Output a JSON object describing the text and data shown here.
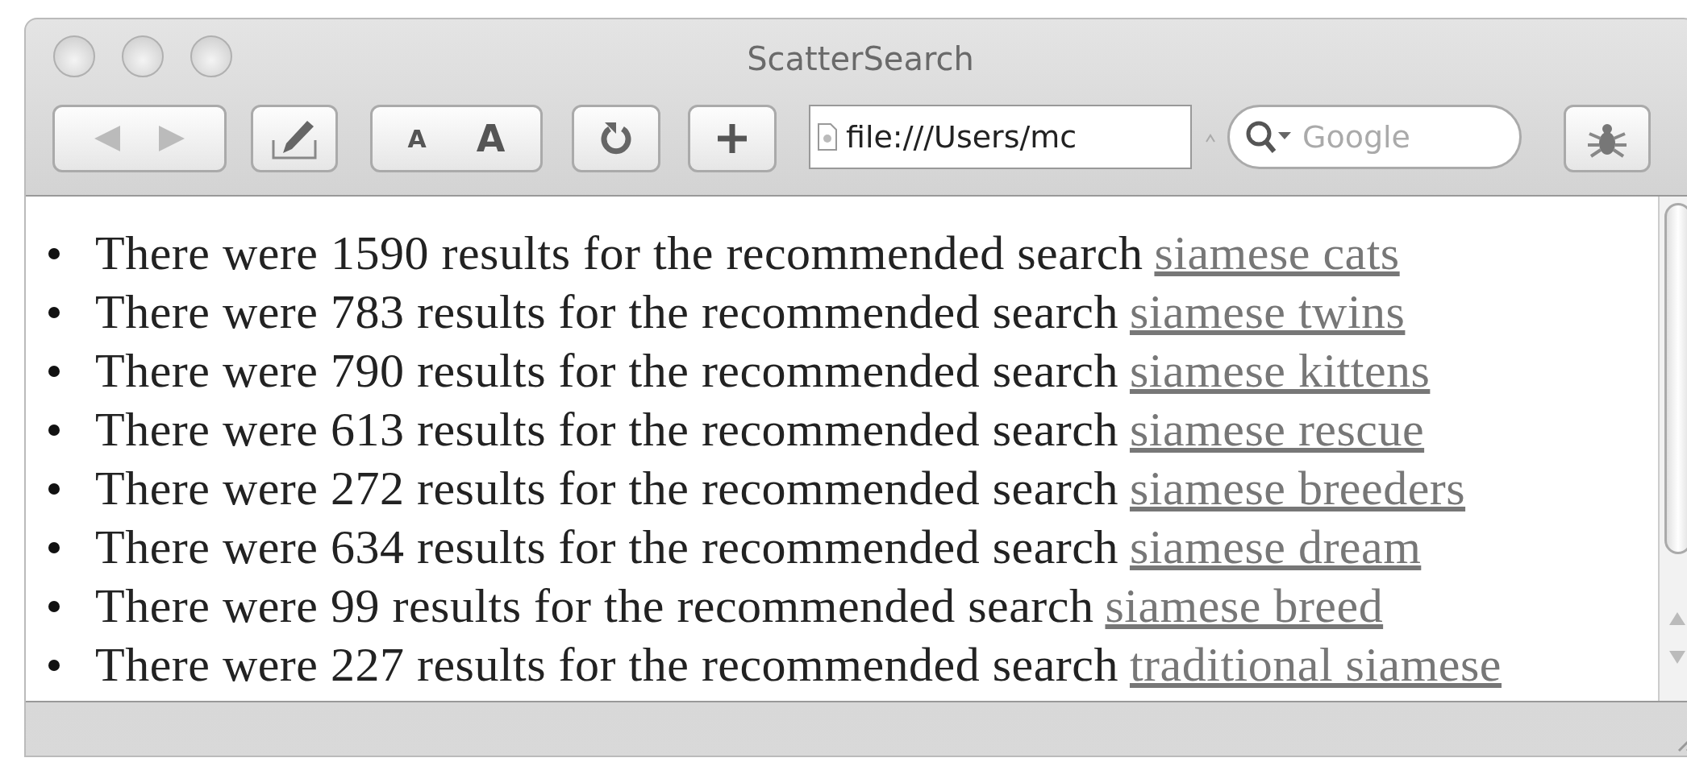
{
  "window": {
    "title": "ScatterSearch"
  },
  "toolbar": {
    "text_size": [
      "A",
      "A"
    ],
    "address": "file:///Users/mc",
    "search": {
      "placeholder": "Google"
    }
  },
  "results": [
    {
      "text": "There were 1590 results for the recommended search",
      "link": "siamese cats"
    },
    {
      "text": "There were 783 results for the recommended search",
      "link": "siamese twins"
    },
    {
      "text": "There were 790 results for the recommended search",
      "link": "siamese kittens"
    },
    {
      "text": "There were 613 results for the recommended search",
      "link": "siamese rescue"
    },
    {
      "text": "There were 272 results for the recommended search",
      "link": "siamese breeders"
    },
    {
      "text": "There were 634 results for the recommended search",
      "link": "siamese dream"
    },
    {
      "text": "There were 99 results for the recommended search",
      "link": "siamese breed"
    },
    {
      "text": "There were 227 results for the recommended search",
      "link": "traditional siamese"
    }
  ]
}
